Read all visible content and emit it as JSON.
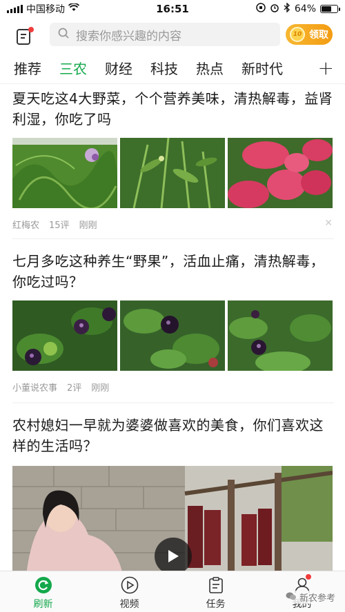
{
  "status_bar": {
    "carrier": "中国移动",
    "time": "16:51",
    "battery_percent": "64%",
    "battery_level": 0.64
  },
  "header": {
    "search_placeholder": "搜索你感兴趣的内容",
    "claim_label": "领取",
    "coin_label": "10"
  },
  "tabs": [
    {
      "label": "推荐",
      "active": false
    },
    {
      "label": "三农",
      "active": true
    },
    {
      "label": "财经",
      "active": false
    },
    {
      "label": "科技",
      "active": false
    },
    {
      "label": "热点",
      "active": false
    },
    {
      "label": "新时代",
      "active": false
    }
  ],
  "tab_plus": "+",
  "feed": [
    {
      "title": "夏天吃这4大野菜，个个营养美味，清热解毒，益肾利湿，你吃了吗",
      "source": "红梅农",
      "comments": "15评",
      "time": "刚刚"
    },
    {
      "title": "七月多吃这种养生“野果”，活血止痛，清热解毒，你吃过吗？",
      "source": "小董说农事",
      "comments": "2评",
      "time": "刚刚"
    },
    {
      "title": "农村媳妇一早就为婆婆做喜欢的美食，你们喜欢这样的生活吗？"
    }
  ],
  "bottom_nav": [
    {
      "label": "刷新",
      "icon": "refresh-icon",
      "active": true
    },
    {
      "label": "视频",
      "icon": "video-play-icon",
      "active": false
    },
    {
      "label": "任务",
      "icon": "task-clipboard-icon",
      "active": false
    },
    {
      "label": "我的",
      "icon": "user-profile-icon",
      "active": false
    }
  ],
  "watermark": "新农参考",
  "colors": {
    "accent_green": "#13a84b",
    "claim_orange": "#f39c12",
    "notification_red": "#f03c3c"
  }
}
